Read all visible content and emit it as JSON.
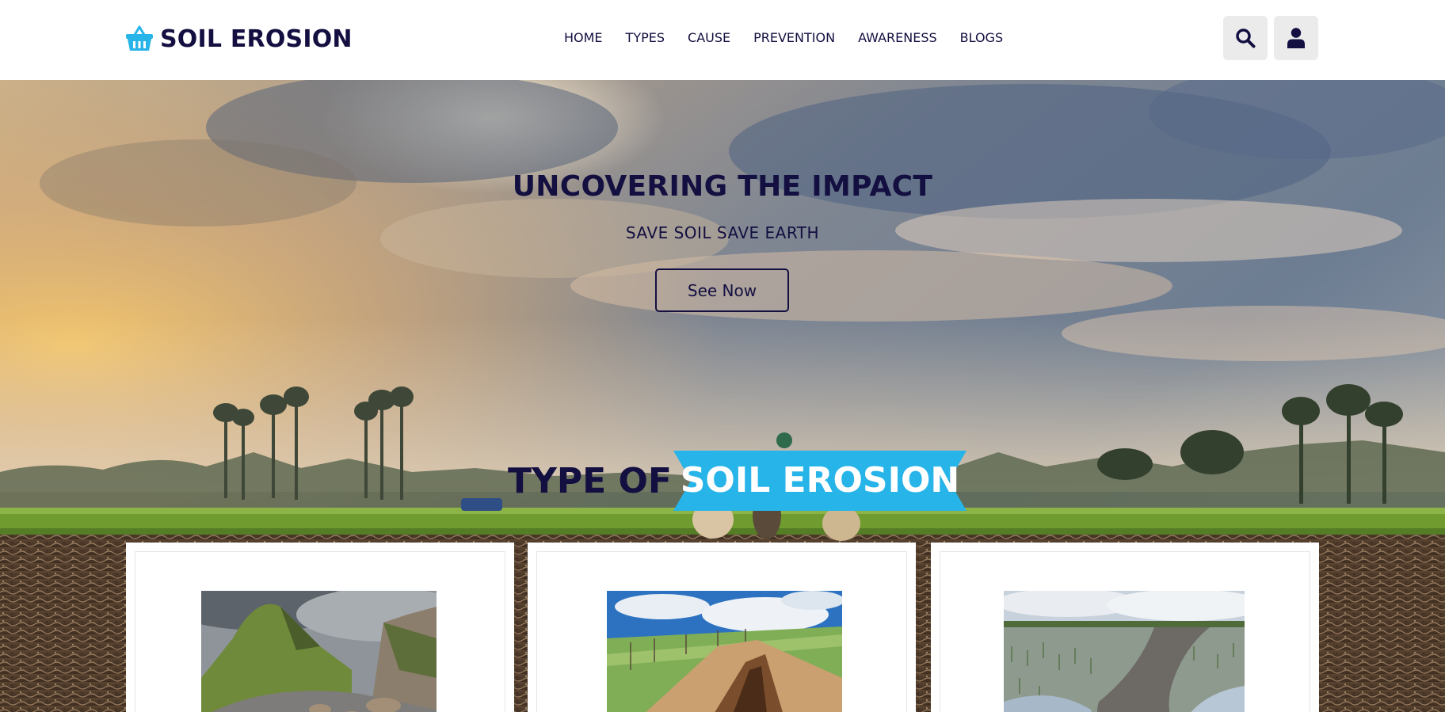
{
  "header": {
    "logo_text": "SOIL EROSION",
    "logo_icon": "basket-icon",
    "nav": [
      "HOME",
      "TYPES",
      "CAUSE",
      "PREVENTION",
      "AWARENESS",
      "BLOGS"
    ],
    "search_icon": "search-icon",
    "user_icon": "user-icon"
  },
  "hero": {
    "title": "UNCOVERING THE IMPACT",
    "subtitle": "SAVE SOIL SAVE EARTH",
    "button_label": "See Now"
  },
  "types_section": {
    "heading_main": "TYPE OF",
    "heading_highlight": "SOIL EROSION"
  },
  "colors": {
    "text": "#130f40",
    "accent": "#27b4e8",
    "button_bg": "#ebebeb"
  },
  "cards": [
    {
      "image": "landslide-road-photo"
    },
    {
      "image": "gully-erosion-photo"
    },
    {
      "image": "flooded-field-photo"
    }
  ]
}
